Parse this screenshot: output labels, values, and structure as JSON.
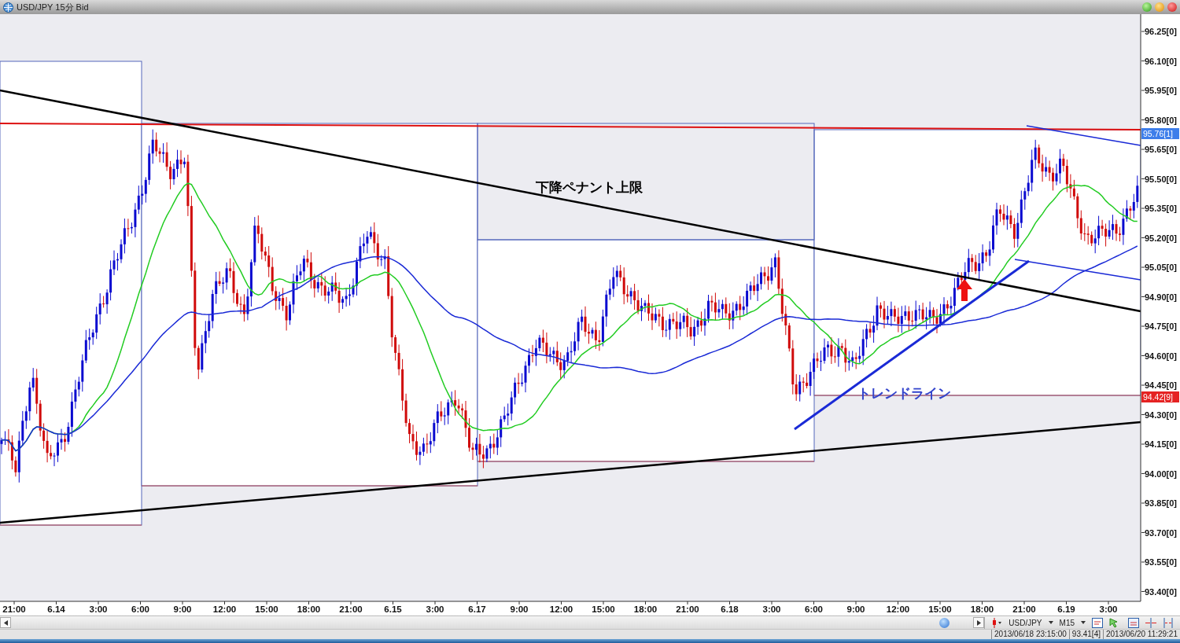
{
  "window": {
    "title": "USD/JPY 15分 Bid"
  },
  "chart": {
    "annotations": [
      {
        "text": "下降ペナント上限",
        "color": "#000000"
      },
      {
        "text": "トレンドライン",
        "color": "#3344cc"
      }
    ],
    "price_axis": [
      "96.25[0]",
      "96.10[0]",
      "95.95[0]",
      "95.80[0]",
      "95.65[0]",
      "95.50[0]",
      "95.35[0]",
      "95.20[0]",
      "95.05[0]",
      "94.90[0]",
      "94.75[0]",
      "94.60[0]",
      "94.45[0]",
      "94.30[0]",
      "94.15[0]",
      "94.00[0]",
      "93.85[0]",
      "93.70[0]",
      "93.55[0]",
      "93.40[0]"
    ],
    "price_markers": [
      {
        "text": "95.76[1]",
        "color": "#3d7eea"
      },
      {
        "text": "94.42[9]",
        "color": "#e52222"
      }
    ],
    "time_axis": [
      "21:00",
      "6.14",
      "3:00",
      "6:00",
      "9:00",
      "12:00",
      "15:00",
      "18:00",
      "21:00",
      "6.15",
      "3:00",
      "6.17",
      "9:00",
      "12:00",
      "15:00",
      "18:00",
      "21:00",
      "6.18",
      "3:00",
      "6:00",
      "9:00",
      "12:00",
      "15:00",
      "18:00",
      "21:00",
      "6.19",
      "3:00"
    ]
  },
  "toolbar": {
    "symbol": "USD/JPY",
    "timeframe": "M15"
  },
  "status_bar": [
    "2013/06/18 23:15:00",
    "93.41[4]",
    "2013/06/20 11:29:21"
  ]
}
